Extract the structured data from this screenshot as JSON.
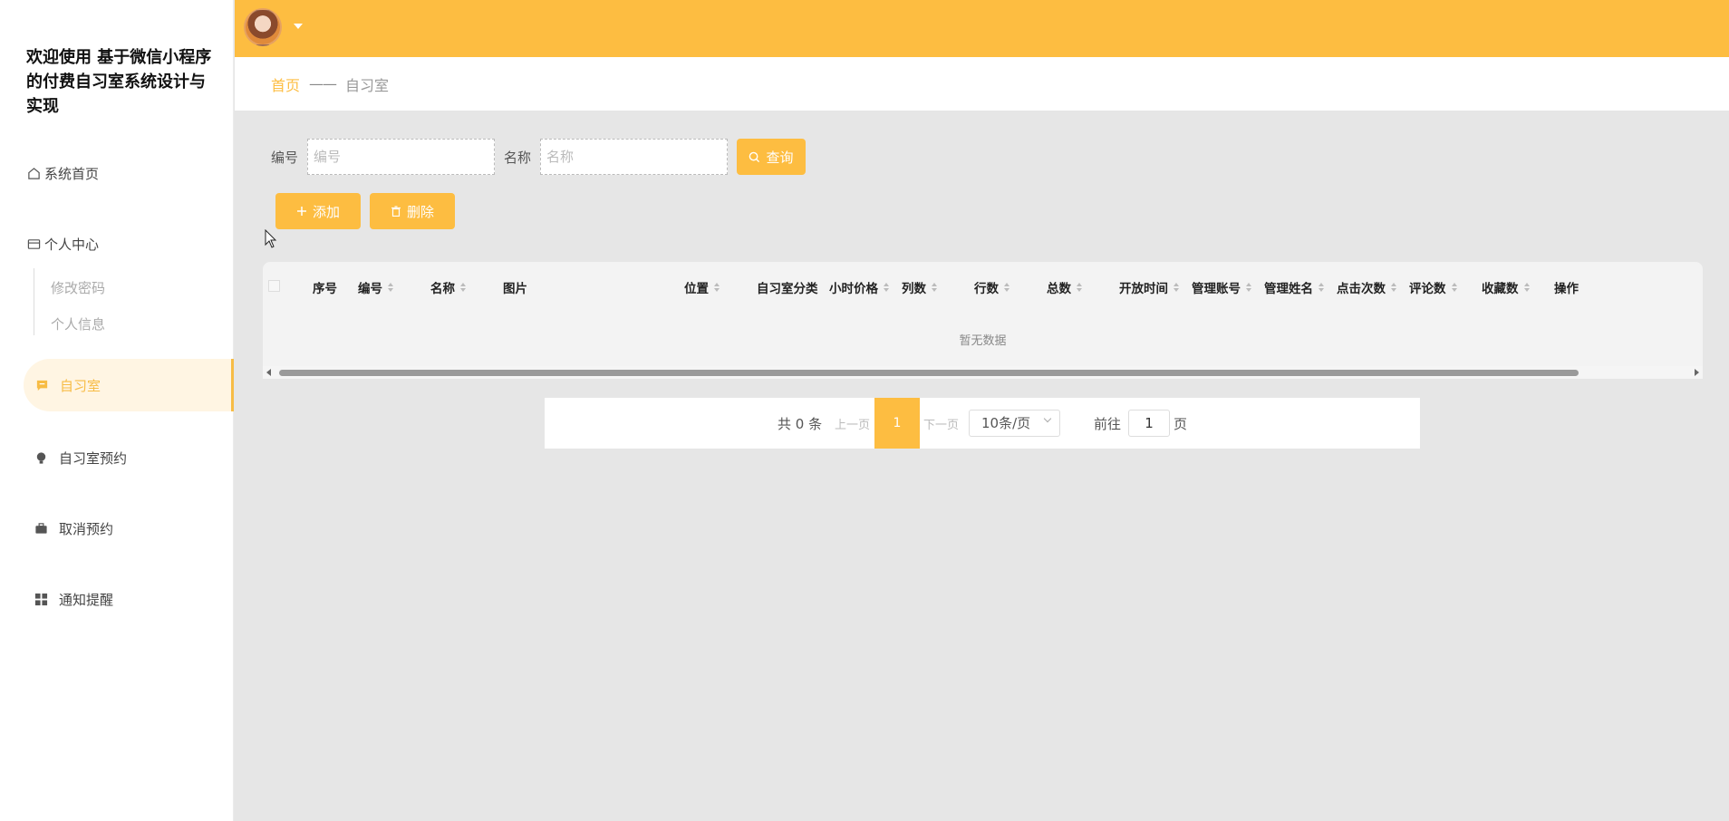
{
  "sidebar": {
    "app_title": "欢迎使用 基于微信小程序的付费自习室系统设计与实现",
    "home": "系统首页",
    "personal_center": "个人中心",
    "sub_items": [
      "修改密码",
      "个人信息"
    ],
    "study_room": "自习室",
    "study_room_booking": "自习室预约",
    "cancel_booking": "取消预约",
    "notification": "通知提醒"
  },
  "breadcrumb": {
    "home": "首页",
    "separator": "——",
    "current": "自习室"
  },
  "search": {
    "field1_label": "编号",
    "field1_placeholder": "编号",
    "field2_label": "名称",
    "field2_placeholder": "名称",
    "query_button": "查询"
  },
  "actions": {
    "add": "添加",
    "delete": "删除"
  },
  "table": {
    "columns": [
      "序号",
      "编号",
      "名称",
      "图片",
      "位置",
      "自习室分类",
      "小时价格",
      "列数",
      "行数",
      "总数",
      "开放时间",
      "管理账号",
      "管理姓名",
      "点击次数",
      "评论数",
      "收藏数",
      "操作"
    ],
    "empty_text": "暂无数据"
  },
  "pagination": {
    "total": "共 0 条",
    "prev": "上一页",
    "current_page": "1",
    "next": "下一页",
    "page_size": "10条/页",
    "goto_prefix": "前往",
    "goto_value": "1",
    "goto_suffix": "页"
  },
  "colors": {
    "accent": "#fdbd41",
    "active_bg": "#fff5e3",
    "background": "#e6e6e6"
  }
}
